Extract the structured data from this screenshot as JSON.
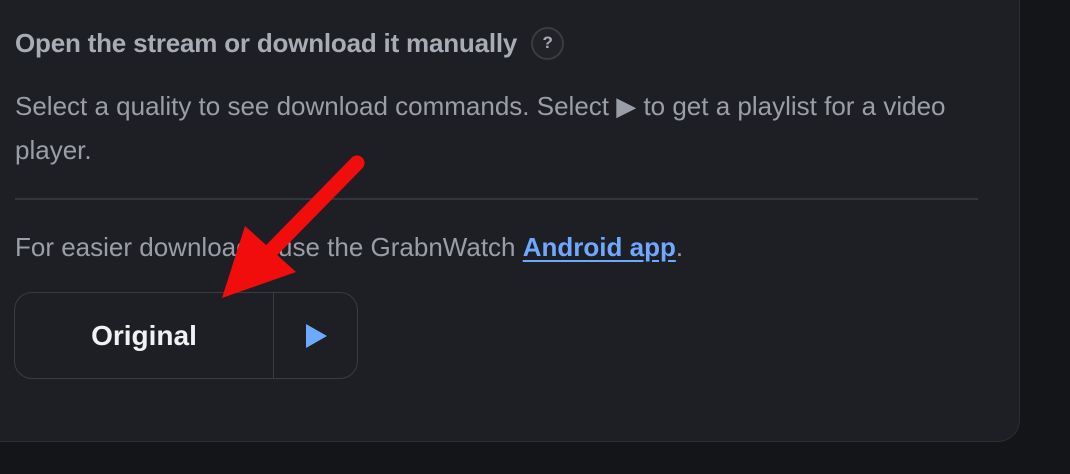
{
  "section": {
    "heading": "Open the stream or download it manually",
    "help_badge": "?",
    "description": "Select a quality to see download commands. Select ▶ to get a playlist for a video player.",
    "note_prefix": "For easier downloads, use the GrabnWatch ",
    "note_link": "Android app",
    "note_suffix": "."
  },
  "quality_options": [
    {
      "label": "Original",
      "play_icon": "play-icon"
    }
  ],
  "colors": {
    "accent": "#6ea8ff",
    "annotation_arrow": "#f20d0d",
    "panel_bg": "#1e1f24",
    "page_bg": "#141518"
  }
}
